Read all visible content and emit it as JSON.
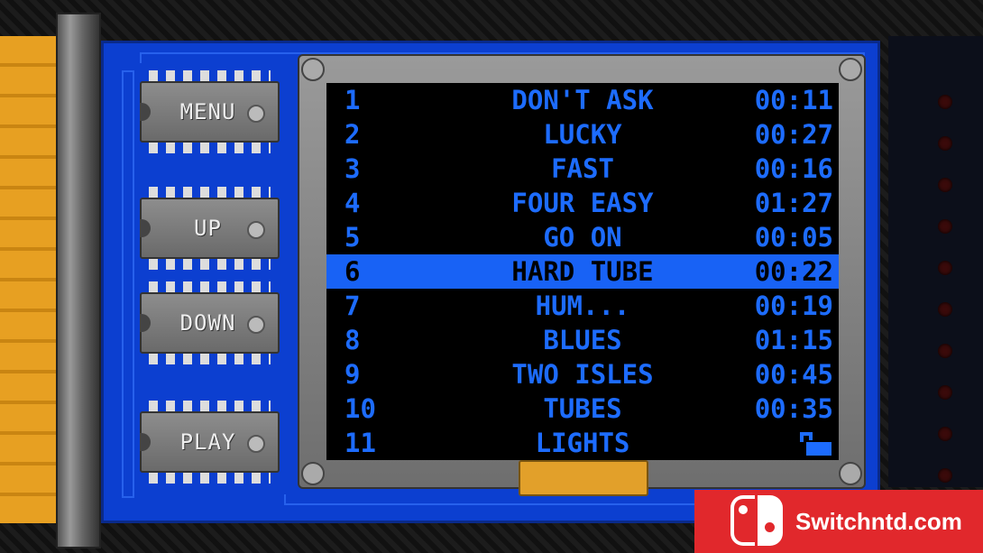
{
  "buttons": {
    "menu": "MENU",
    "up": "UP",
    "down": "DOWN",
    "play": "PLAY"
  },
  "tracks": [
    {
      "number": "1",
      "title": "DON'T ASK",
      "duration": "00:11"
    },
    {
      "number": "2",
      "title": "LUCKY",
      "duration": "00:27"
    },
    {
      "number": "3",
      "title": "FAST",
      "duration": "00:16"
    },
    {
      "number": "4",
      "title": "FOUR EASY",
      "duration": "01:27"
    },
    {
      "number": "5",
      "title": "GO ON",
      "duration": "00:05"
    },
    {
      "number": "6",
      "title": "HARD TUBE",
      "duration": "00:22",
      "selected": true
    },
    {
      "number": "7",
      "title": "HUM...",
      "duration": "00:19"
    },
    {
      "number": "8",
      "title": "BLUES",
      "duration": "01:15"
    },
    {
      "number": "9",
      "title": "TWO ISLES",
      "duration": "00:45"
    },
    {
      "number": "10",
      "title": "TUBES",
      "duration": "00:35"
    },
    {
      "number": "11",
      "title": "LIGHTS",
      "duration": null,
      "icon": "lock-icon"
    }
  ],
  "colors": {
    "text": "#1d6cff",
    "highlight": "#1862f5",
    "board": "#0c3fd0"
  },
  "watermark": {
    "text": "Switchntd.com"
  }
}
